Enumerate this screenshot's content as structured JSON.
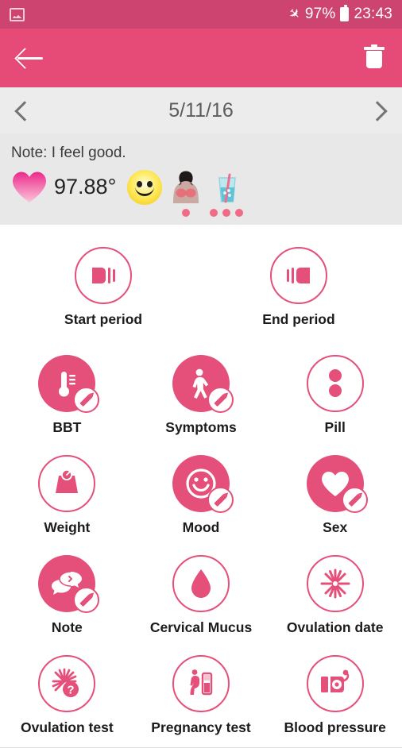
{
  "status_bar": {
    "image_icon": "image-icon",
    "airplane_icon": "airplane-mode-icon",
    "battery_percent": "97%",
    "battery_icon": "battery-icon",
    "time": "23:43"
  },
  "app_bar": {
    "back_icon": "back-arrow-icon",
    "delete_icon": "trash-icon"
  },
  "date_nav": {
    "prev_icon": "chevron-left-icon",
    "date": "5/11/16",
    "next_icon": "chevron-right-icon"
  },
  "summary": {
    "note": "Note: I feel good.",
    "temperature": "97.88°",
    "heart_icon": "heart-icon",
    "mood_icon": "smiley-face-icon",
    "symptom_icon": "breast-pain-icon",
    "symptom_dots": 1,
    "drink_icon": "water-glass-icon",
    "drink_dots": 3
  },
  "period_buttons": [
    {
      "label": "Start period",
      "icon": "start-period-icon",
      "filled": false
    },
    {
      "label": "End period",
      "icon": "end-period-icon",
      "filled": false
    }
  ],
  "tracker_rows": [
    [
      {
        "label": "BBT",
        "icon": "thermometer-icon",
        "filled": true,
        "edit": true
      },
      {
        "label": "Symptoms",
        "icon": "person-icon",
        "filled": true,
        "edit": true
      },
      {
        "label": "Pill",
        "icon": "pill-icon",
        "filled": false,
        "edit": false
      }
    ],
    [
      {
        "label": "Weight",
        "icon": "scale-icon",
        "filled": false,
        "edit": false
      },
      {
        "label": "Mood",
        "icon": "smiley-icon",
        "filled": true,
        "edit": true
      },
      {
        "label": "Sex",
        "icon": "heart-icon",
        "filled": true,
        "edit": true
      }
    ],
    [
      {
        "label": "Note",
        "icon": "speech-bubble-icon",
        "filled": true,
        "edit": true
      },
      {
        "label": "Cervical Mucus",
        "icon": "droplet-icon",
        "filled": false,
        "edit": false
      },
      {
        "label": "Ovulation date",
        "icon": "starburst-icon",
        "filled": false,
        "edit": false
      }
    ],
    [
      {
        "label": "Ovulation test",
        "icon": "starburst-question-icon",
        "filled": false,
        "edit": false
      },
      {
        "label": "Pregnancy test",
        "icon": "pregnancy-test-icon",
        "filled": false,
        "edit": false
      },
      {
        "label": "Blood pressure",
        "icon": "blood-pressure-icon",
        "filled": false,
        "edit": false
      }
    ]
  ],
  "colors": {
    "status_bar": "#CE4470",
    "app_bar": "#E54B76",
    "accent": "#E4507A",
    "panel": "#E8E8E8",
    "date_bar": "#ECECEC"
  }
}
